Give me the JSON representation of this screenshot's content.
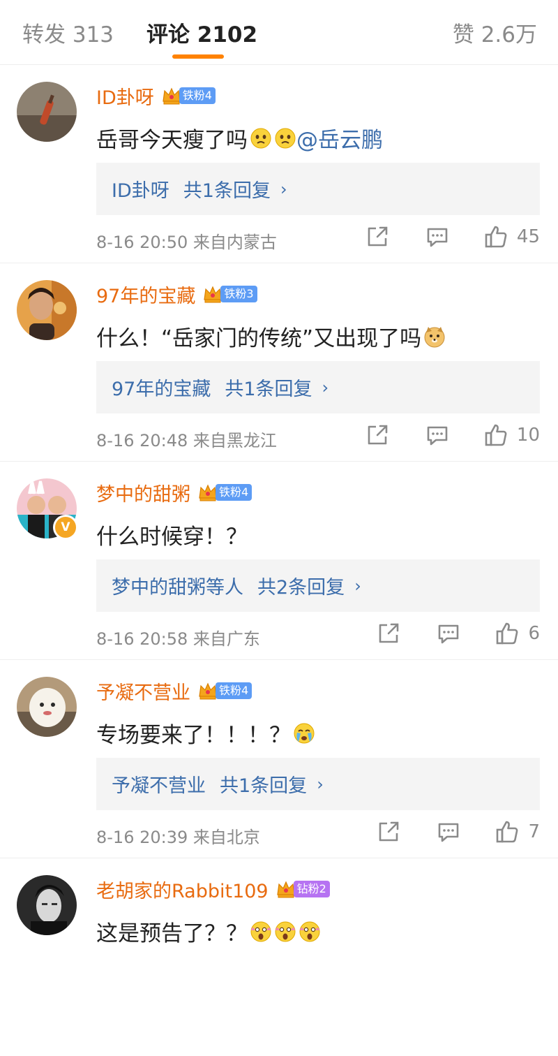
{
  "tabs": {
    "repost": "转发 313",
    "comments": "评论 2102",
    "likes": "赞 2.6万"
  },
  "comments": [
    {
      "username": "ID卦呀",
      "fan_badge": "铁粉4",
      "text": "岳哥今天瘦了吗",
      "emojis": [
        "disappointed-emoji",
        "disappointed-emoji"
      ],
      "mention": "@岳云鹏",
      "reply_name": "ID卦呀",
      "reply_count": "共1条回复",
      "reply_chevron": "›",
      "time": "8-16 20:50",
      "source": "来自内蒙古",
      "likes": "45"
    },
    {
      "username": "97年的宝藏",
      "fan_badge": "铁粉3",
      "text": "什么！“岳家门的传统”又出现了吗",
      "emojis": [
        "doge-emoji"
      ],
      "mention": "",
      "reply_name": "97年的宝藏",
      "reply_count": "共1条回复",
      "reply_chevron": "›",
      "time": "8-16 20:48",
      "source": "来自黑龙江",
      "likes": "10"
    },
    {
      "username": "梦中的甜粥",
      "fan_badge": "铁粉4",
      "text": "什么时候穿！？",
      "emojis": [],
      "mention": "",
      "reply_name": "梦中的甜粥等人",
      "reply_count": "共2条回复",
      "reply_chevron": "›",
      "time": "8-16 20:58",
      "source": "来自广东",
      "likes": "6"
    },
    {
      "username": "予凝不营业",
      "fan_badge": "铁粉4",
      "text": "专场要来了！！！？",
      "emojis": [
        "crying-emoji"
      ],
      "mention": "",
      "reply_name": "予凝不营业",
      "reply_count": "共1条回复",
      "reply_chevron": "›",
      "time": "8-16 20:39",
      "source": "来自北京",
      "likes": "7"
    },
    {
      "username": "老胡家的Rabbit109",
      "fan_badge": "钻粉2",
      "text": "这是预告了？？",
      "emojis": [
        "scream-emoji",
        "scream-emoji",
        "scream-emoji"
      ],
      "mention": "",
      "reply_name": "",
      "reply_count": "",
      "reply_chevron": "",
      "time": "",
      "source": "",
      "likes": ""
    }
  ],
  "colors": {
    "accent": "#ff8200",
    "username": "#e86b10",
    "link": "#3c6dab",
    "fan_badge_blue": "#5d9cf5",
    "fan_badge_purple": "#b673f2"
  },
  "icons": {
    "share": "share-icon",
    "reply": "comment-icon",
    "like": "thumbs-up-icon",
    "crown": "crown-icon",
    "verified": "verified-badge-icon"
  }
}
